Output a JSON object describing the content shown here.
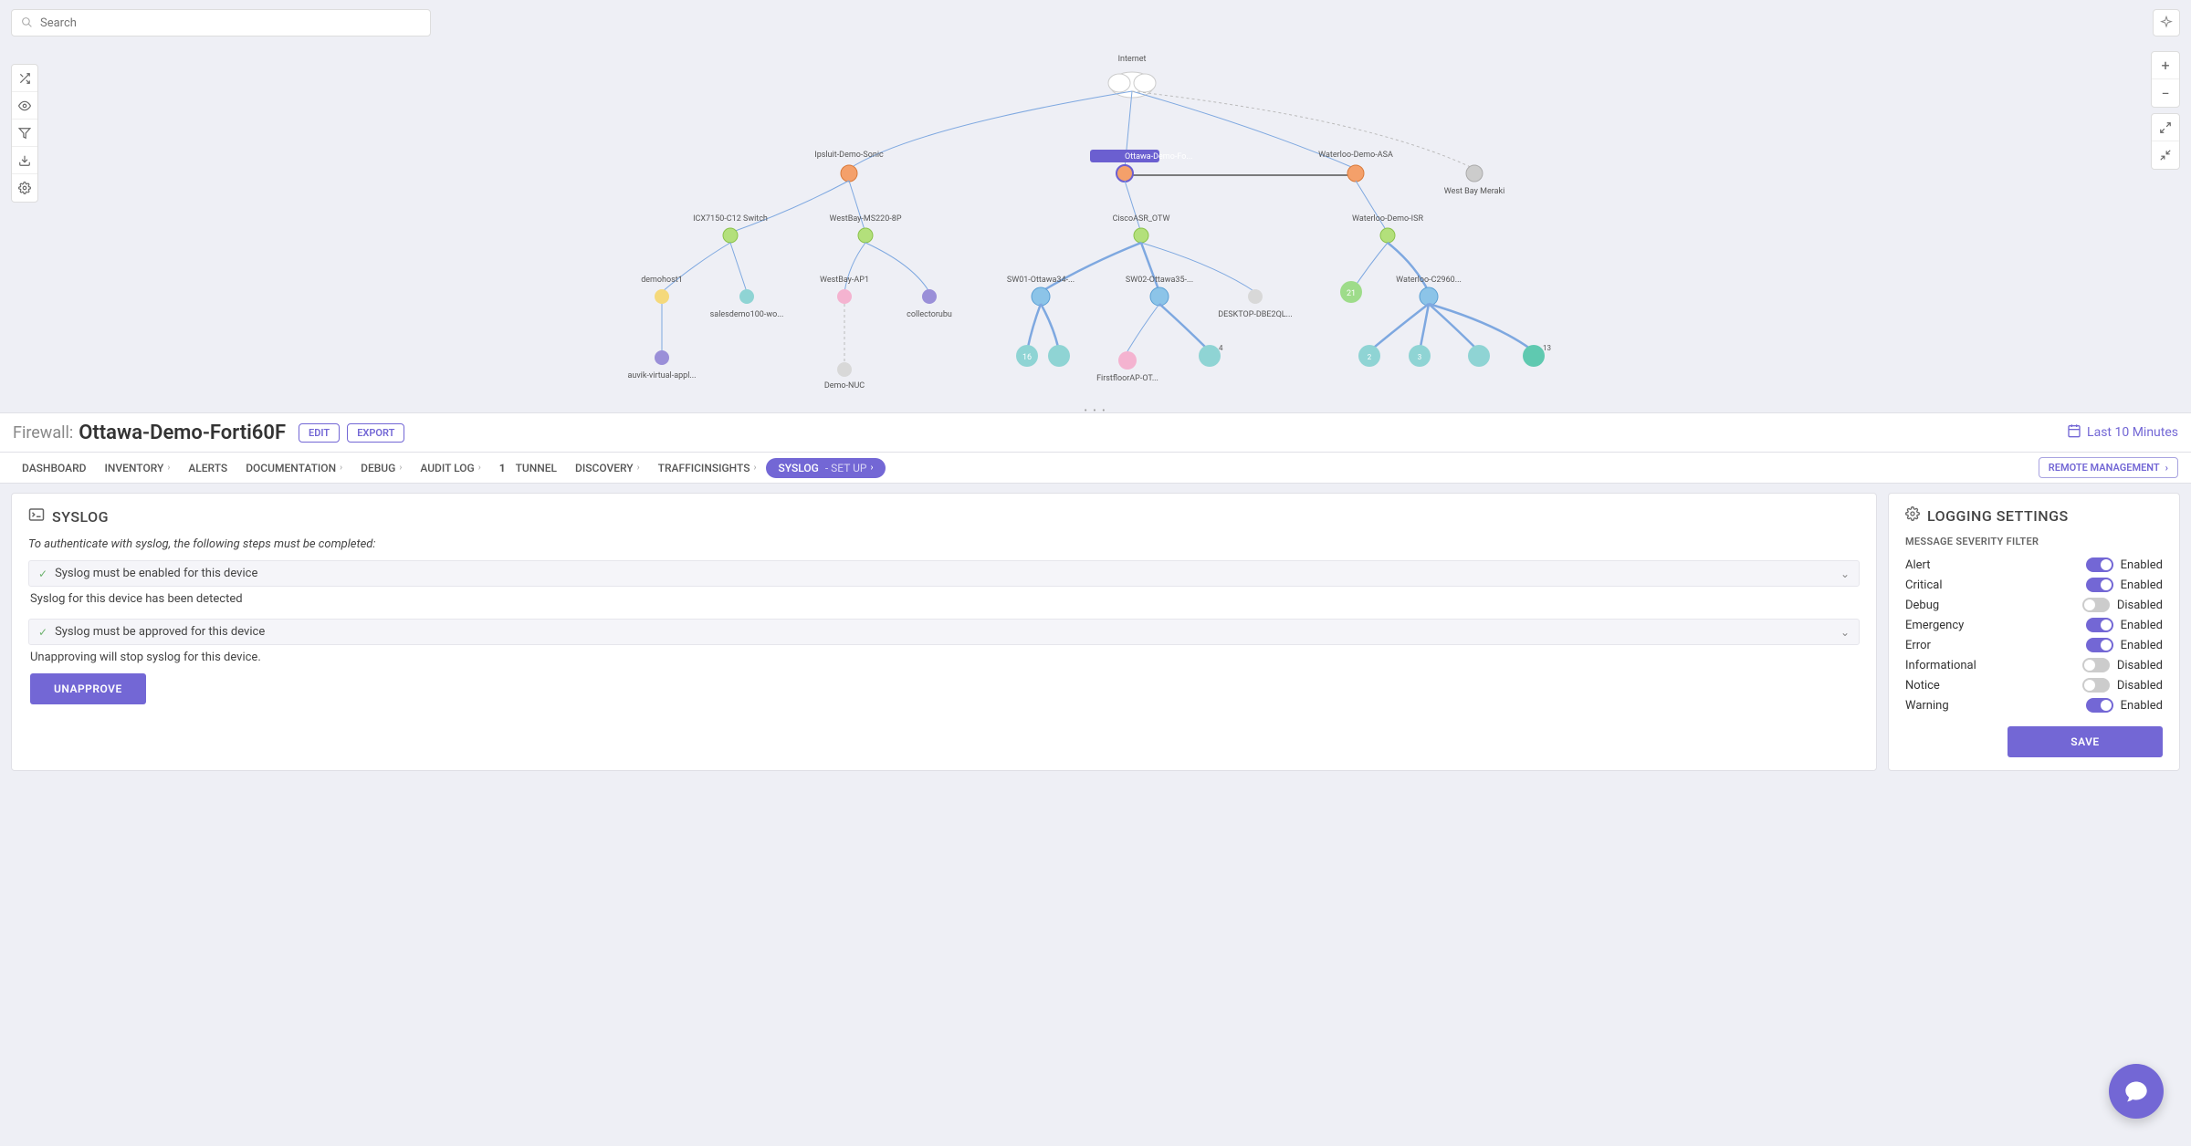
{
  "search": {
    "placeholder": "Search"
  },
  "header": {
    "type_label": "Firewall:",
    "device_name": "Ottawa-Demo-Forti60F",
    "edit_label": "EDIT",
    "export_label": "EXPORT",
    "time_range": "Last 10 Minutes"
  },
  "tabs": {
    "dashboard": "DASHBOARD",
    "inventory": "INVENTORY",
    "alerts": "ALERTS",
    "documentation": "DOCUMENTATION",
    "debug": "DEBUG",
    "auditlog": "AUDIT LOG",
    "tunnel_count": "1",
    "tunnel": "TUNNEL",
    "discovery": "DISCOVERY",
    "traffic": "TRAFFICINSIGHTS",
    "syslog": "SYSLOG",
    "syslog_sub": "- SET UP",
    "remote": "REMOTE MANAGEMENT"
  },
  "syslog_panel": {
    "title": "SYSLOG",
    "auth_note": "To authenticate with syslog, the following steps must be completed:",
    "step1_title": "Syslog must be enabled for this device",
    "step1_body": "Syslog for this device has been detected",
    "step2_title": "Syslog must be approved for this device",
    "step2_body": "Unapproving will stop syslog for this device.",
    "unapprove_label": "UNAPPROVE"
  },
  "logging_panel": {
    "title": "LOGGING SETTINGS",
    "filter_heading": "MESSAGE SEVERITY FILTER",
    "save_label": "SAVE",
    "levels": [
      {
        "name": "Alert",
        "enabled": true,
        "state": "Enabled"
      },
      {
        "name": "Critical",
        "enabled": true,
        "state": "Enabled"
      },
      {
        "name": "Debug",
        "enabled": false,
        "state": "Disabled"
      },
      {
        "name": "Emergency",
        "enabled": true,
        "state": "Enabled"
      },
      {
        "name": "Error",
        "enabled": true,
        "state": "Enabled"
      },
      {
        "name": "Informational",
        "enabled": false,
        "state": "Disabled"
      },
      {
        "name": "Notice",
        "enabled": false,
        "state": "Disabled"
      },
      {
        "name": "Warning",
        "enabled": true,
        "state": "Enabled"
      }
    ]
  },
  "topology": {
    "root": "Internet",
    "row1": [
      {
        "label": "Ipsluit-Demo-Sonic",
        "selected": false
      },
      {
        "label": "Ottawa-Demo-Fo...",
        "selected": true
      },
      {
        "label": "Waterloo-Demo-ASA",
        "selected": false
      },
      {
        "label": "West Bay Meraki",
        "selected": false,
        "gray": true
      }
    ],
    "row2": [
      "ICX7150-C12 Switch",
      "WestBay-MS220-8P",
      "CiscoASR_OTW",
      "Waterloo-Demo-ISR"
    ],
    "row3": [
      "demohost1",
      "",
      "WestBay-AP1",
      "",
      "SW01-Ottawa34-...",
      "SW02-Ottawa35-...",
      "DESKTOP-DBE2QL...",
      "",
      "Waterloo-C2960..."
    ],
    "row3_sub": [
      "salesdemo100-wo...",
      "collectorubu"
    ],
    "row4": [
      "auvik-virtual-appl...",
      "Demo-NUC",
      "FirstfloorAP-OT..."
    ]
  }
}
